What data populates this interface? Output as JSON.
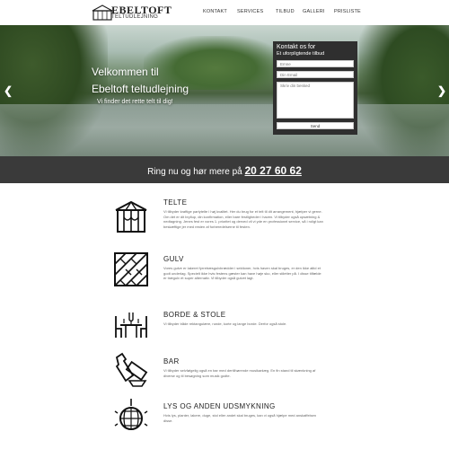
{
  "header": {
    "logo": {
      "title": "EBELTOFT",
      "subtitle": "TELTUDLEJNING",
      "icon": "tent-logo-icon"
    },
    "nav": [
      "KONTAKT",
      "SERVICES",
      "TILBUD",
      "GALLERI",
      "PRISLISTE"
    ]
  },
  "hero": {
    "title_line1": "Velkommen til",
    "title_line2": "Ebeltoft teltudlejning",
    "tagline": "Vi finder det rette telt til dig!",
    "prev_icon": "chevron-left-icon",
    "next_icon": "chevron-right-icon"
  },
  "contact_form": {
    "title": "Kontakt os for",
    "subtitle": "Et uforpligtende tilbud",
    "name_placeholder": "Emne",
    "email_placeholder": "Din Email",
    "message_placeholder": "Skriv din besked",
    "submit_label": "Send"
  },
  "phone_band": {
    "text": "Ring nu og hør mere på",
    "number": "20 27 60 62"
  },
  "services": [
    {
      "icon": "tent-icon",
      "title": "TELTE",
      "text": "Vi tilbyder kraftige partytelte i høj kvalitet. Her du brug for et telt til dit arrangement, hjælper vi gerne. Om det er dit bryllup, din konfirmation, eller bare festligheder i haven. Vi tilbyder også opsætning & nedtagning. Jenes fest er vores 1. prioritet og derved vil vi yde en professionel service, så i roligt kan beskæftige jer med resten af forberedelserne til festen."
    },
    {
      "icon": "parquet-floor-icon",
      "title": "GULV",
      "text": "Vores gulve er lakeret fyrretræsgulvbrædder i sektioner, hvis haven skal bruges, er den ikke altid et godt underlag. Specielt ikke hvis festens gæster kan have høje sko, eller stiletter på. I disse tilfælde er trægulv et super alternativ. Vi tilbyder også gulvet lagt."
    },
    {
      "icon": "table-chairs-icon",
      "title": "BORDE & STOLE",
      "text": "Vi tilbyder både rektangulære, runde, korte og lange borde. Derfor også stole."
    },
    {
      "icon": "bottles-icon",
      "title": "BAR",
      "text": "Vi tilbyder selvfølgelig også en bar med dertilhørende musikanlæg. En fin stand til skænkning af diverse og til besøgning som musik godte."
    },
    {
      "icon": "disco-ball-icon",
      "title": "LYS OG ANDEN UDSMYKNING",
      "text": "Hvis lys, planter, lakere, duge, stol eller andet skal bruges, kan vi også hjælpe med anskaffelsen disse."
    }
  ]
}
